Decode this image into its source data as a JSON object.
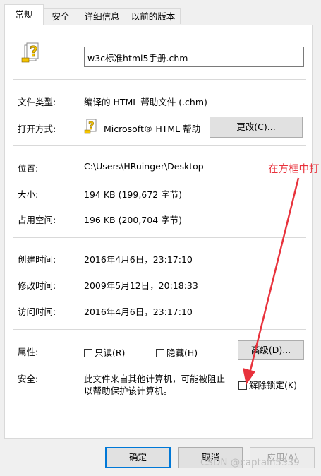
{
  "tabs": [
    {
      "label": "常规"
    },
    {
      "label": "安全"
    },
    {
      "label": "详细信息"
    },
    {
      "label": "以前的版本"
    }
  ],
  "file": {
    "name": "w3c标准html5手册.chm",
    "icon": "help-file-icon"
  },
  "rows": {
    "type_label": "文件类型:",
    "type_value": "编译的 HTML 帮助文件 (.chm)",
    "open_label": "打开方式:",
    "open_value": "Microsoft® HTML 帮助",
    "change_button": "更改(C)...",
    "location_label": "位置:",
    "location_value": "C:\\Users\\HRuinger\\Desktop",
    "size_label": "大小:",
    "size_value": "194 KB (199,672 字节)",
    "disk_label": "占用空间:",
    "disk_value": "196 KB (200,704 字节)",
    "created_label": "创建时间:",
    "created_value": "2016年4月6日，23:17:10",
    "modified_label": "修改时间:",
    "modified_value": "2009年5月12日，20:18:33",
    "accessed_label": "访问时间:",
    "accessed_value": "2016年4月6日，23:17:10",
    "attr_label": "属性:",
    "readonly_label": "只读(R)",
    "hidden_label": "隐藏(H)",
    "advanced_button": "高级(D)...",
    "security_label": "安全:",
    "security_text_1": "此文件来自其他计算机，可能被阻止",
    "security_text_2": "以帮助保护该计算机。",
    "unblock_label": "解除锁定(K)"
  },
  "annotation": {
    "text": "在方框中打",
    "color": "#e8323c"
  },
  "footer": {
    "ok": "确定",
    "cancel": "取消",
    "apply": "应用(A)"
  },
  "watermark": "CSDN @captain5339"
}
